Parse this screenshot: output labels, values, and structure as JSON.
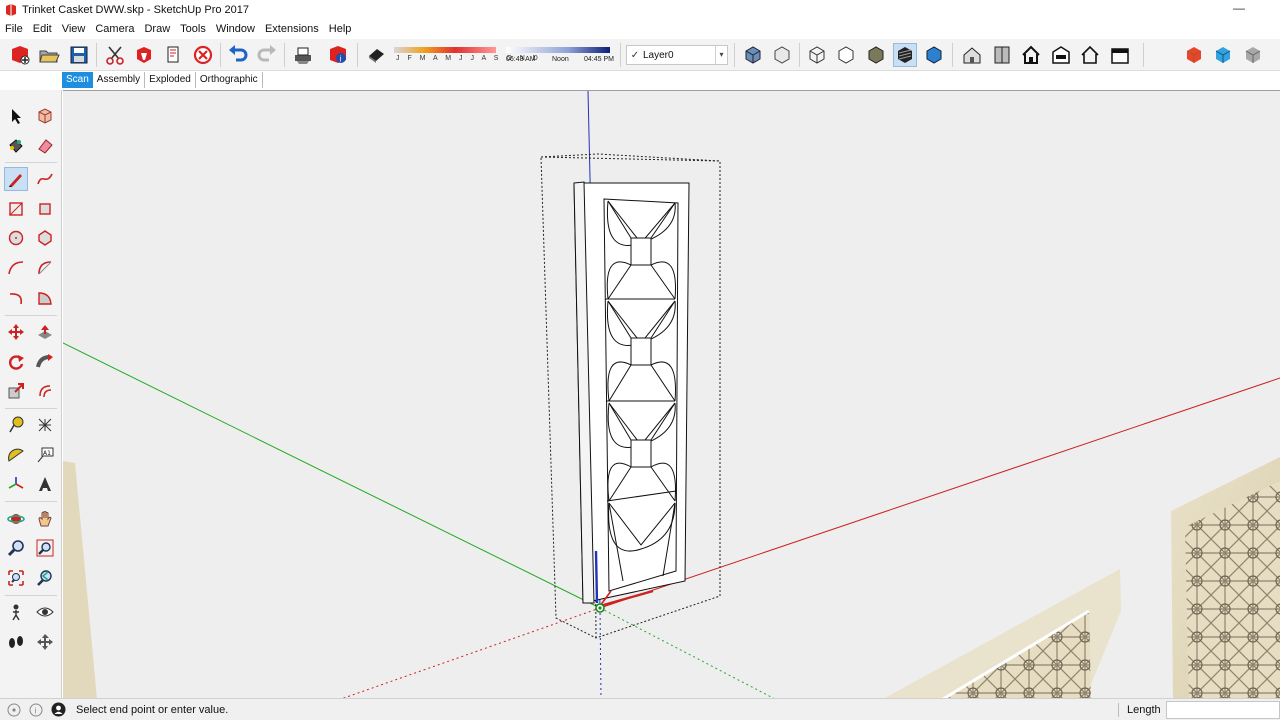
{
  "window": {
    "title": "Trinket Casket DWW.skp - SketchUp Pro 2017",
    "minimize_glyph": "—"
  },
  "menu": [
    "File",
    "Edit",
    "View",
    "Camera",
    "Draw",
    "Tools",
    "Window",
    "Extensions",
    "Help"
  ],
  "shadow": {
    "months": "J F M A M J J A S O N D",
    "time_start": "06:43 AM",
    "time_mid": "Noon",
    "time_end": "04:45 PM"
  },
  "layer": {
    "check": "✓",
    "current": "Layer0",
    "dropdown": "▾"
  },
  "scenes": [
    "Scan",
    "Assembly",
    "Exploded",
    "Orthographic"
  ],
  "status": {
    "message": "Select end point or enter value.",
    "vcb_label": "Length",
    "vcb_value": ""
  },
  "colors": {
    "axis_red": "#cc2222",
    "axis_green": "#22aa22",
    "axis_blue": "#2233bb",
    "scene_tab_active": "#1e8fe0",
    "viewport_bg": "#eeeeee"
  },
  "icons": {
    "toolbar": [
      "new-model-icon",
      "open-icon",
      "save-icon",
      "cut-icon",
      "paint-bucket-icon",
      "erase-icon",
      "cancel-icon",
      "undo-icon",
      "redo-icon",
      "print-icon",
      "model-info-icon",
      "eraser-shadow-icon",
      "iso-view-icon",
      "top-view-icon",
      "front-view-icon",
      "right-view-icon",
      "back-view-icon",
      "left-view-icon",
      "xray-icon",
      "wireframe-icon",
      "hidden-line-icon",
      "shaded-icon",
      "shaded-texture-icon",
      "monochrome-icon",
      "section-plane-icon",
      "section-display-icon",
      "component-icon",
      "house-icon",
      "warehouse-icon",
      "outline-house-icon",
      "red-cube-icon",
      "blue-cube-icon",
      "gray-cube-icon"
    ],
    "left": [
      "select-icon",
      "make-component-icon",
      "paint-bucket-icon",
      "eraser-icon",
      "pencil-icon",
      "freehand-icon",
      "rectangle-icon",
      "rotated-rectangle-icon",
      "circle-icon",
      "polygon-icon",
      "arc-icon",
      "two-point-arc-icon",
      "three-point-arc-icon",
      "pie-icon",
      "move-icon",
      "push-pull-icon",
      "rotate-icon",
      "follow-me-icon",
      "scale-icon",
      "offset-icon",
      "tape-measure-icon",
      "dimension-icon",
      "protractor-icon",
      "text-icon",
      "axes-icon",
      "3d-text-icon",
      "orbit-icon",
      "pan-icon",
      "zoom-icon",
      "zoom-window-icon",
      "zoom-extents-icon",
      "previous-view-icon",
      "position-camera-icon",
      "look-around-icon",
      "walk-icon",
      "section-plane-icon"
    ]
  }
}
